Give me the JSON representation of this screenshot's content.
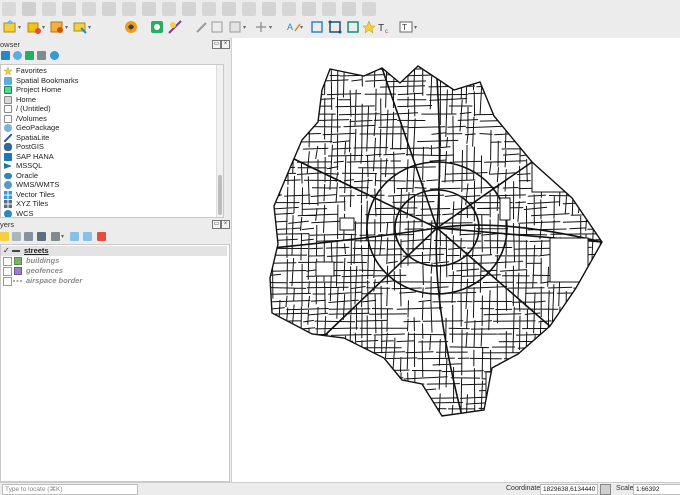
{
  "browser_panel": {
    "title": "owser",
    "items": [
      {
        "label": "Favorites",
        "icon": "star-icon"
      },
      {
        "label": "Spatial Bookmarks",
        "icon": "bookmark-icon"
      },
      {
        "label": "Project Home",
        "icon": "project-home-icon"
      },
      {
        "label": "Home",
        "icon": "home-folder-icon"
      },
      {
        "label": "/ (Untitled)",
        "icon": "drive-icon"
      },
      {
        "label": "/Volumes",
        "icon": "folder-icon"
      },
      {
        "label": "GeoPackage",
        "icon": "geopackage-icon"
      },
      {
        "label": "SpatiaLite",
        "icon": "spatialite-icon"
      },
      {
        "label": "PostGIS",
        "icon": "postgis-icon"
      },
      {
        "label": "SAP HANA",
        "icon": "sap-hana-icon"
      },
      {
        "label": "MSSQL",
        "icon": "mssql-icon"
      },
      {
        "label": "Oracle",
        "icon": "oracle-icon"
      },
      {
        "label": "WMS/WMTS",
        "icon": "wms-icon"
      },
      {
        "label": "Vector Tiles",
        "icon": "vector-tiles-icon"
      },
      {
        "label": "XYZ Tiles",
        "icon": "xyz-tiles-icon"
      },
      {
        "label": "WCS",
        "icon": "wcs-icon"
      }
    ]
  },
  "layers_panel": {
    "title": "yers",
    "layers": [
      {
        "name": "streets",
        "checked": true,
        "symbol": "line",
        "color": "#111111"
      },
      {
        "name": "buildings",
        "checked": false,
        "symbol": "fill",
        "color": "#7cb36a"
      },
      {
        "name": "geofences",
        "checked": false,
        "symbol": "fill",
        "color": "#9b7fc7"
      },
      {
        "name": "airspace border",
        "checked": false,
        "symbol": "dashed",
        "color": "#555555"
      }
    ]
  },
  "status_bar": {
    "locator_placeholder": "Type to locate (⌘K)",
    "coordinate_label": "Coordinate",
    "coordinate_value": "1829638,6134440",
    "scale_label": "Scale",
    "scale_value": "1:66392"
  },
  "colors": {
    "accent": "#3a7bd5",
    "street": "#111111",
    "panel_bg": "#ececec"
  }
}
